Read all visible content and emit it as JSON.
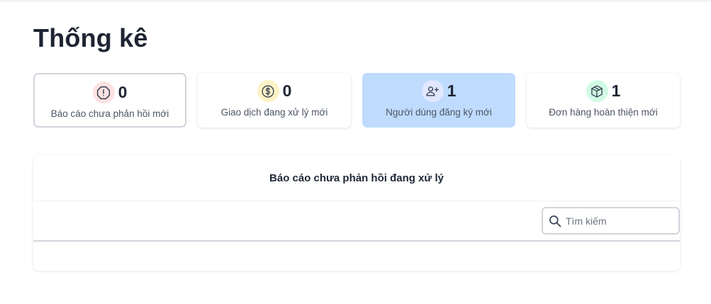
{
  "page": {
    "title": "Thống kê"
  },
  "stats": [
    {
      "count": "0",
      "label": "Báo cáo chưa phản hồi mới",
      "icon": "alert-octagon-icon",
      "icon_bg": "#fee2e2",
      "icon_color": "#374151"
    },
    {
      "count": "0",
      "label": "Giao dịch đang xử lý mới",
      "icon": "dollar-coin-icon",
      "icon_bg": "#fef3c7",
      "icon_color": "#374151"
    },
    {
      "count": "1",
      "label": "Người dùng đăng ký mới",
      "icon": "user-plus-icon",
      "icon_bg": "#e0e7ff",
      "icon_color": "#374151",
      "active_bg": "#bfdbfe"
    },
    {
      "count": "1",
      "label": "Đơn hàng hoàn thiện mới",
      "icon": "package-icon",
      "icon_bg": "#d1fae5",
      "icon_color": "#374151"
    }
  ],
  "panel": {
    "title": "Báo cáo chưa phản hồi đang xử lý",
    "search": {
      "placeholder": "Tìm kiếm",
      "value": ""
    }
  }
}
